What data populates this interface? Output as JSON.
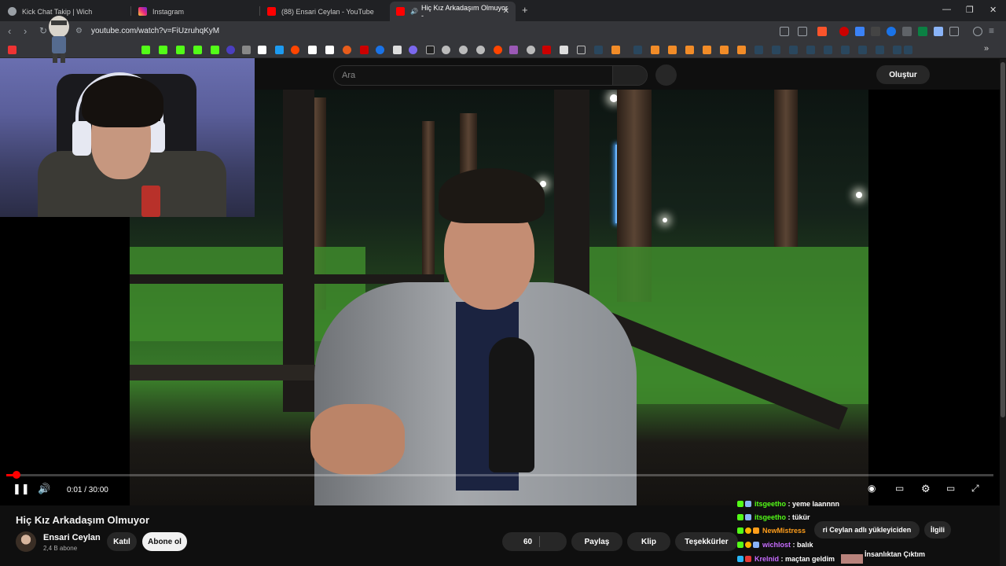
{
  "browser": {
    "tabs": [
      {
        "title": "Kick Chat Takip | Wich",
        "active": false
      },
      {
        "title": "Instagram",
        "active": false
      },
      {
        "title": "(88) Ensari Ceylan - YouTube",
        "active": false
      },
      {
        "title": "Hiç Kız Arkadaşım Olmuyor -",
        "active": true
      }
    ],
    "new_tab": "+",
    "window_buttons": {
      "minimize": "—",
      "restore": "❐",
      "close": "✕"
    },
    "url": "youtube.com/watch?v=FiUzruhqKyM"
  },
  "youtube": {
    "search_placeholder": "Ara",
    "create_label": "Oluştur",
    "video": {
      "title": "Hiç Kız Arkadaşım Olmuyor",
      "time": "0:01 / 30:00",
      "progress": 0.01
    },
    "channel": {
      "name": "Ensari Ceylan",
      "subs": "2,4 B abone"
    },
    "actions": {
      "join": "Katıl",
      "subscribe": "Abone ol",
      "likes": "60",
      "share": "Paylaş",
      "clip": "Klip",
      "thanks": "Teşekkürler"
    },
    "chips": {
      "upload": "ri Ceylan adlı yükleyiciden",
      "related": "İlgili"
    },
    "recommendation": {
      "title": "İnsanlıktan Çıktım"
    }
  },
  "chat": [
    {
      "user": "itsgeetho",
      "message": "yeme laannnn",
      "color": "#53fc18"
    },
    {
      "user": "itsgeetho",
      "message": "tükür",
      "color": "#53fc18"
    },
    {
      "user": "NewMistress",
      "message": "",
      "color": "#ff9e1b"
    },
    {
      "user": "wichlost",
      "message": "balık",
      "color": "#c76cff"
    },
    {
      "user": "Krelnid",
      "message": "maçtan geldim",
      "color": "#c76cff"
    }
  ],
  "colors": {
    "accent_red": "#ff0000",
    "chrome_bg": "#202124",
    "toolbar_bg": "#35363a",
    "page_bg": "#0f0f0f"
  }
}
